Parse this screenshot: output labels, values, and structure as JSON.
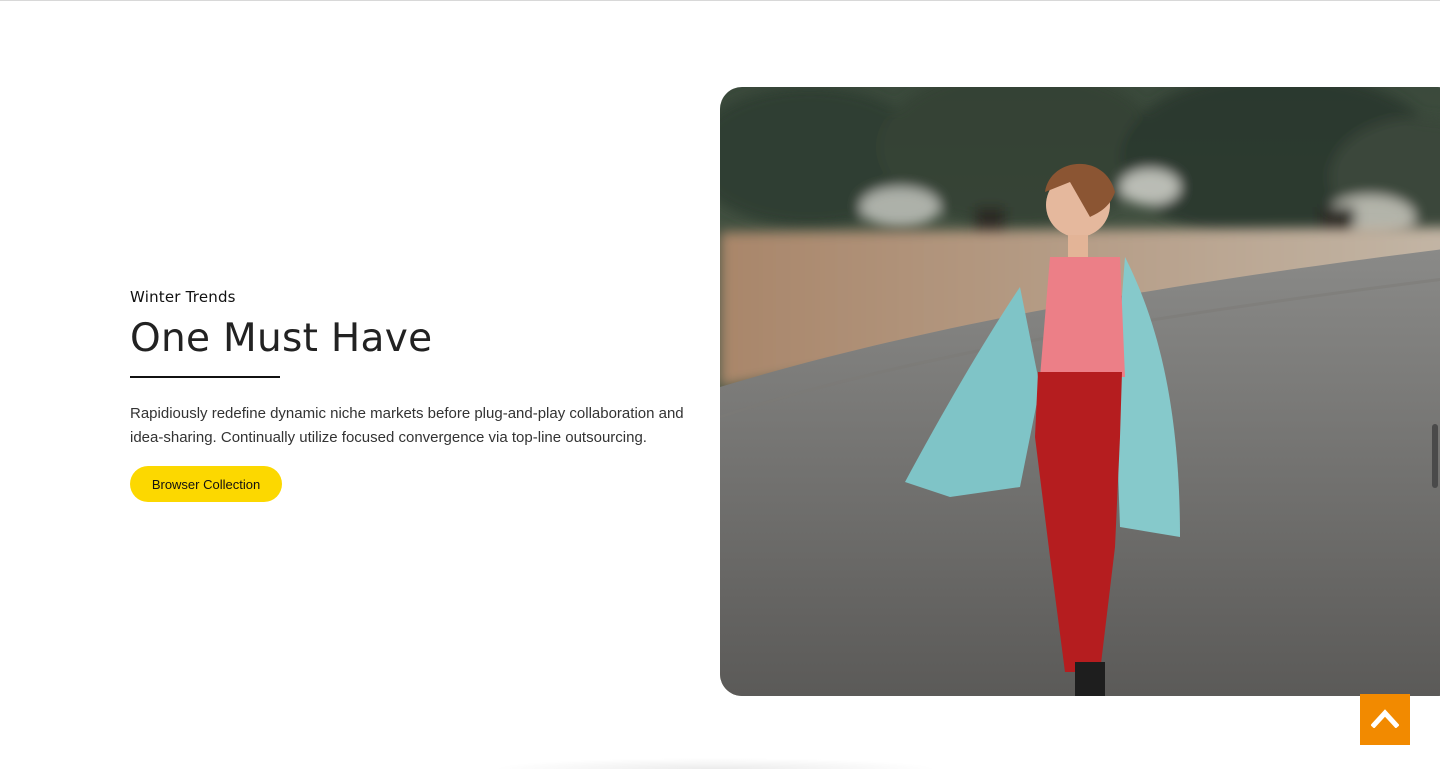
{
  "promo": {
    "eyebrow": "Winter Trends",
    "headline": "One Must Have",
    "description": "Rapidiously redefine dynamic niche markets before plug-and-play collaboration and idea-sharing. Continually utilize focused convergence via top-line outsourcing.",
    "cta_label": "Browser Collection"
  },
  "colors": {
    "cta_background": "#fcd800",
    "back_to_top_background": "#f28a00"
  },
  "icons": {
    "back_to_top": "chevron-up-icon"
  }
}
